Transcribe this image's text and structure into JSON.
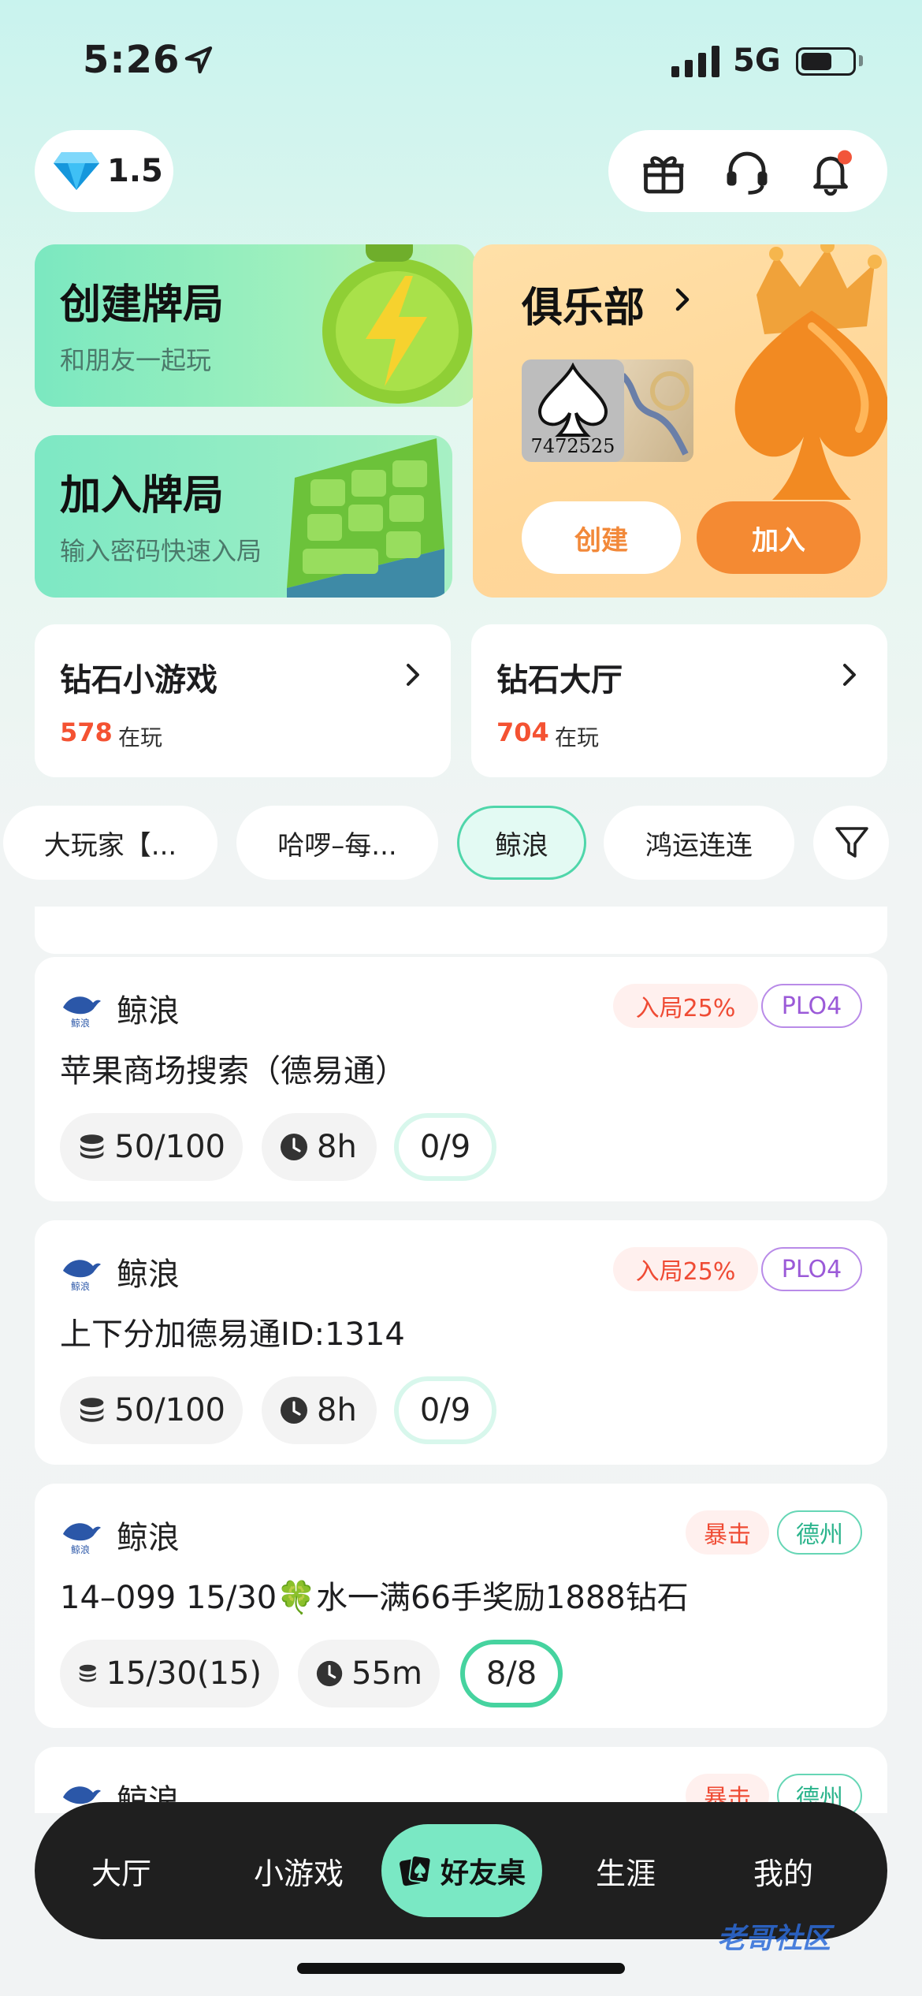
{
  "status_bar": {
    "time": "5:26",
    "network": "5G",
    "battery_level": 0.6
  },
  "header": {
    "diamond_balance": "1.5",
    "icons": [
      "gift-icon",
      "headset-icon",
      "bell-icon"
    ]
  },
  "create_card": {
    "title": "创建牌局",
    "subtitle": "和朋友一起玩"
  },
  "join_card": {
    "title": "加入牌局",
    "subtitle": "输入密码快速入局"
  },
  "club_card": {
    "title": "俱乐部",
    "club_id": "7472525",
    "create_label": "创建",
    "join_label": "加入"
  },
  "games": [
    {
      "title": "钻石小游戏",
      "count": "578",
      "suffix": "在玩"
    },
    {
      "title": "钻石大厅",
      "count": "704",
      "suffix": "在玩"
    }
  ],
  "filter_chips": [
    {
      "label": "大玩家【...",
      "active": false
    },
    {
      "label": "哈啰–每...",
      "active": false
    },
    {
      "label": "鲸浪",
      "active": true
    },
    {
      "label": "鸿运连连",
      "active": false
    }
  ],
  "tables": [
    {
      "club": "鲸浪",
      "tags": [
        {
          "label": "入局25%",
          "style": "red"
        },
        {
          "label": "PLO4",
          "style": "purple"
        }
      ],
      "title": "苹果商场搜索（德易通）",
      "blinds": "50/100",
      "duration": "8h",
      "seats": "0/9"
    },
    {
      "club": "鲸浪",
      "tags": [
        {
          "label": "入局25%",
          "style": "red"
        },
        {
          "label": "PLO4",
          "style": "purple"
        }
      ],
      "title": "上下分加德易通ID:1314",
      "blinds": "50/100",
      "duration": "8h",
      "seats": "0/9"
    },
    {
      "club": "鲸浪",
      "tags": [
        {
          "label": "暴击",
          "style": "red"
        },
        {
          "label": "德州",
          "style": "teal"
        }
      ],
      "title": "14–099 15/30🍀水一满66手奖励1888钻石",
      "blinds": "15/30(15)",
      "duration": "55m",
      "seats": "8/8"
    },
    {
      "club": "鲸浪",
      "tags": [
        {
          "label": "暴击",
          "style": "red"
        },
        {
          "label": "德州",
          "style": "teal"
        }
      ]
    }
  ],
  "bottom_nav": [
    "大厅",
    "小游戏",
    "好友桌",
    "生涯",
    "我的"
  ],
  "active_nav": "好友桌",
  "watermark": "老哥社区",
  "colors": {
    "accent_green": "#7ae8c4",
    "orange": "#f48a33",
    "red": "#ef4b34"
  }
}
